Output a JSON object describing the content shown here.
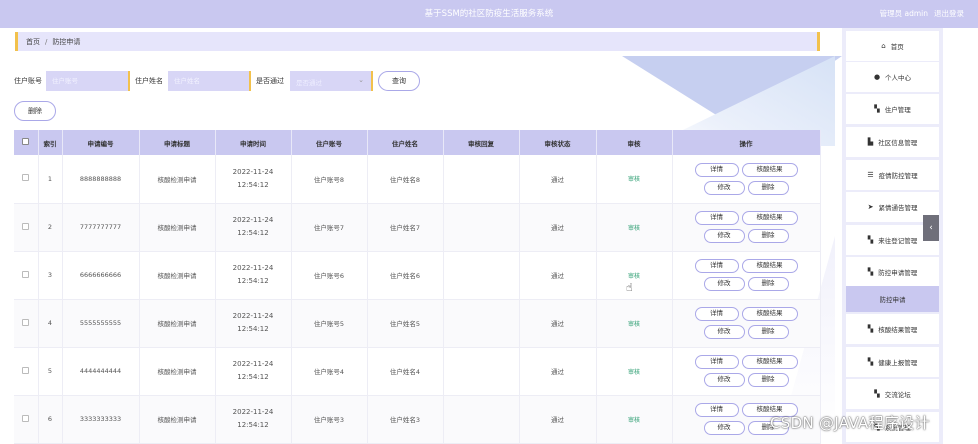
{
  "header": {
    "title": "基于SSM的社区防疫生活服务系统",
    "user": "管理员 admin",
    "logout": "退出登录"
  },
  "breadcrumb": {
    "home": "首页",
    "separator": "/",
    "current": "防控申请"
  },
  "search": {
    "account_label": "住户账号",
    "account_placeholder": "住户账号",
    "name_label": "住户姓名",
    "name_placeholder": "住户姓名",
    "pass_label": "是否通过",
    "pass_placeholder": "是否通过",
    "query_button": "查询",
    "delete_button": "删除"
  },
  "table": {
    "columns": [
      "索引",
      "申请编号",
      "申请标题",
      "申请时间",
      "住户账号",
      "住户姓名",
      "审核回复",
      "审核状态",
      "审核",
      "操作"
    ],
    "rows": [
      {
        "index": "1",
        "code": "8888888888",
        "title": "核酸检测申请",
        "time": "2022-11-24 12:54:12",
        "account": "住户账号8",
        "name": "住户姓名8",
        "reply": "",
        "status": "通过",
        "audit": "审核"
      },
      {
        "index": "2",
        "code": "7777777777",
        "title": "核酸检测申请",
        "time": "2022-11-24 12:54:12",
        "account": "住户账号7",
        "name": "住户姓名7",
        "reply": "",
        "status": "通过",
        "audit": "审核"
      },
      {
        "index": "3",
        "code": "6666666666",
        "title": "核酸检测申请",
        "time": "2022-11-24 12:54:12",
        "account": "住户账号6",
        "name": "住户姓名6",
        "reply": "",
        "status": "通过",
        "audit": "审核"
      },
      {
        "index": "4",
        "code": "5555555555",
        "title": "核酸检测申请",
        "time": "2022-11-24 12:54:12",
        "account": "住户账号5",
        "name": "住户姓名5",
        "reply": "",
        "status": "通过",
        "audit": "审核"
      },
      {
        "index": "5",
        "code": "4444444444",
        "title": "核酸检测申请",
        "time": "2022-11-24 12:54:12",
        "account": "住户账号4",
        "name": "住户姓名4",
        "reply": "",
        "status": "通过",
        "audit": "审核"
      },
      {
        "index": "6",
        "code": "3333333333",
        "title": "核酸检测申请",
        "time": "2022-11-24 12:54:12",
        "account": "住户账号3",
        "name": "住户姓名3",
        "reply": "",
        "status": "通过",
        "audit": "审核"
      }
    ],
    "actions": {
      "detail": "详情",
      "result": "核酸结果",
      "edit": "修改",
      "delete": "删除"
    }
  },
  "sidebar": {
    "items": [
      {
        "label": "首页",
        "icon": "home-icon"
      },
      {
        "label": "个人中心",
        "icon": "user-icon"
      },
      {
        "label": "住户管理",
        "icon": "grid-icon"
      },
      {
        "label": "社区信息管理",
        "icon": "building-icon"
      },
      {
        "label": "疫情防控管理",
        "icon": "list-icon"
      },
      {
        "label": "紧情通告管理",
        "icon": "send-icon"
      },
      {
        "label": "来往登记管理",
        "icon": "grid-icon"
      },
      {
        "label": "防控申请管理",
        "icon": "grid-icon"
      },
      {
        "label": "防控申请",
        "icon": ""
      },
      {
        "label": "核酸结果管理",
        "icon": "grid-icon"
      },
      {
        "label": "健康上报管理",
        "icon": "grid-icon"
      },
      {
        "label": "交流论坛",
        "icon": "grid-icon"
      },
      {
        "label": "系统管理",
        "icon": "grid-icon"
      }
    ]
  },
  "watermark": "CSDN @JAVA程序设计",
  "colors": {
    "header": "#c9c8f0",
    "accent": "#f2c14c",
    "button_border": "#aaa8e8",
    "audit_link": "#2a9d70"
  }
}
